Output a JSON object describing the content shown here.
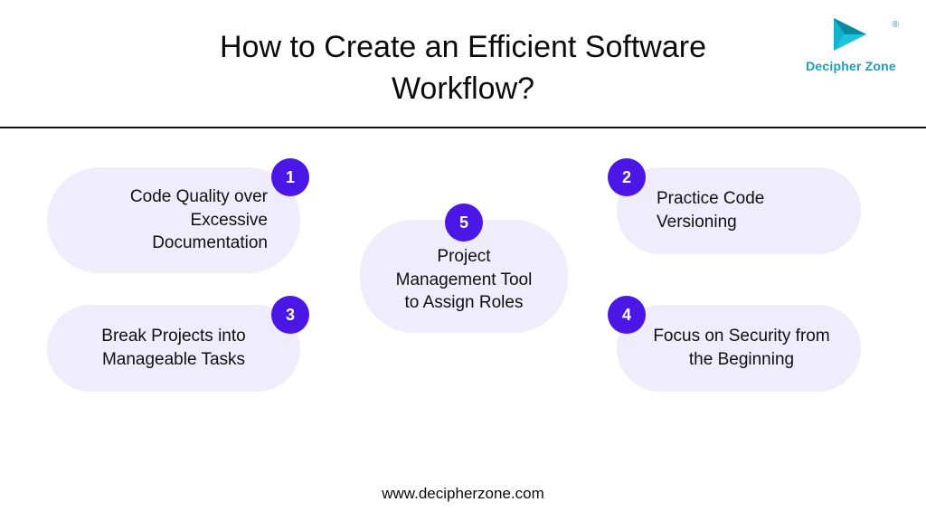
{
  "header": {
    "title": "How to Create an Efficient Software Workflow?"
  },
  "brand": {
    "name": "Decipher Zone",
    "registered": "®",
    "accent": "#1aa0b8",
    "accent_dark": "#0a7f94"
  },
  "colors": {
    "pill_bg": "#efecfb",
    "badge_bg": "#4b17e6",
    "rule": "#111111"
  },
  "items": [
    {
      "n": "1",
      "label": "Code Quality over Excessive Documentation"
    },
    {
      "n": "2",
      "label": "Practice Code Versioning"
    },
    {
      "n": "3",
      "label": "Break Projects into Manageable Tasks"
    },
    {
      "n": "4",
      "label": "Focus on Security from the Beginning"
    },
    {
      "n": "5",
      "label": "Project Management Tool to Assign Roles"
    }
  ],
  "footer": {
    "url_text": "www.decipherzone.com"
  }
}
